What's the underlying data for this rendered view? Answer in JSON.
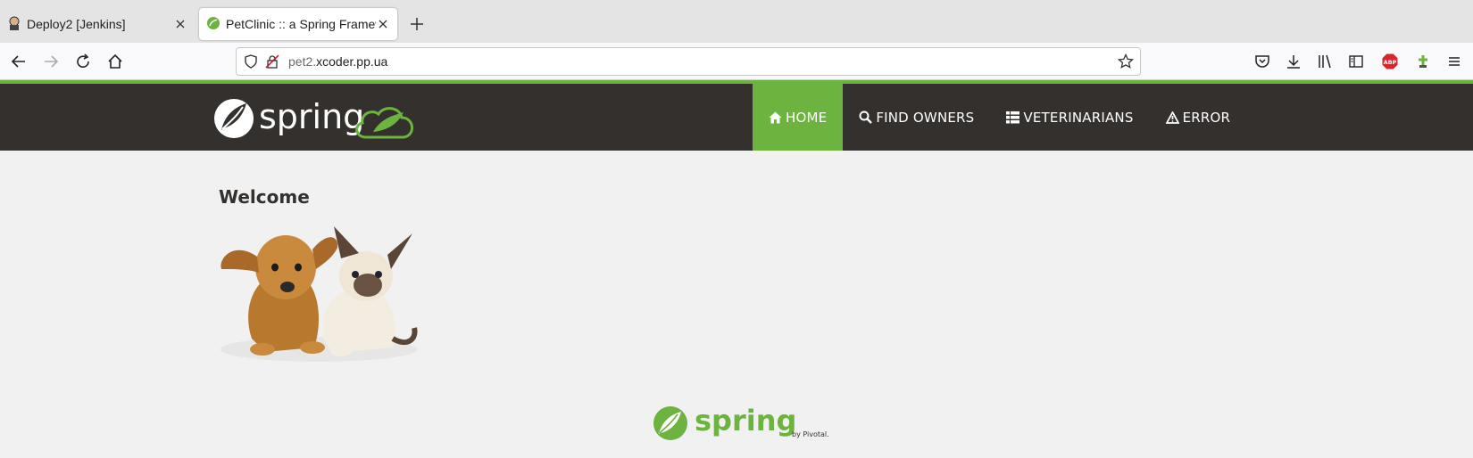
{
  "browser": {
    "tabs": [
      {
        "title": "Deploy2 [Jenkins]",
        "active": false
      },
      {
        "title": "PetClinic :: a Spring Framew",
        "active": true
      }
    ],
    "url": {
      "prefix": "pet2.",
      "domain": "xcoder.pp.ua"
    },
    "toolbar_icons": [
      "pocket-icon",
      "download-icon",
      "library-icon",
      "sidebar-icon",
      "adblock-icon",
      "extension-icon",
      "menu-icon"
    ],
    "adblock_label": "ABP"
  },
  "site": {
    "brand": "spring",
    "nav": [
      {
        "label": "HOME",
        "icon": "home-icon",
        "active": true
      },
      {
        "label": "FIND OWNERS",
        "icon": "search-icon",
        "active": false
      },
      {
        "label": "VETERINARIANS",
        "icon": "list-icon",
        "active": false
      },
      {
        "label": "ERROR",
        "icon": "warning-icon",
        "active": false
      }
    ],
    "heading": "Welcome",
    "footer_brand": "spring",
    "footer_by": "by Pivotal."
  },
  "colors": {
    "accent": "#6db33f",
    "header_bg": "#34302d",
    "page_bg": "#f1f1f1"
  }
}
